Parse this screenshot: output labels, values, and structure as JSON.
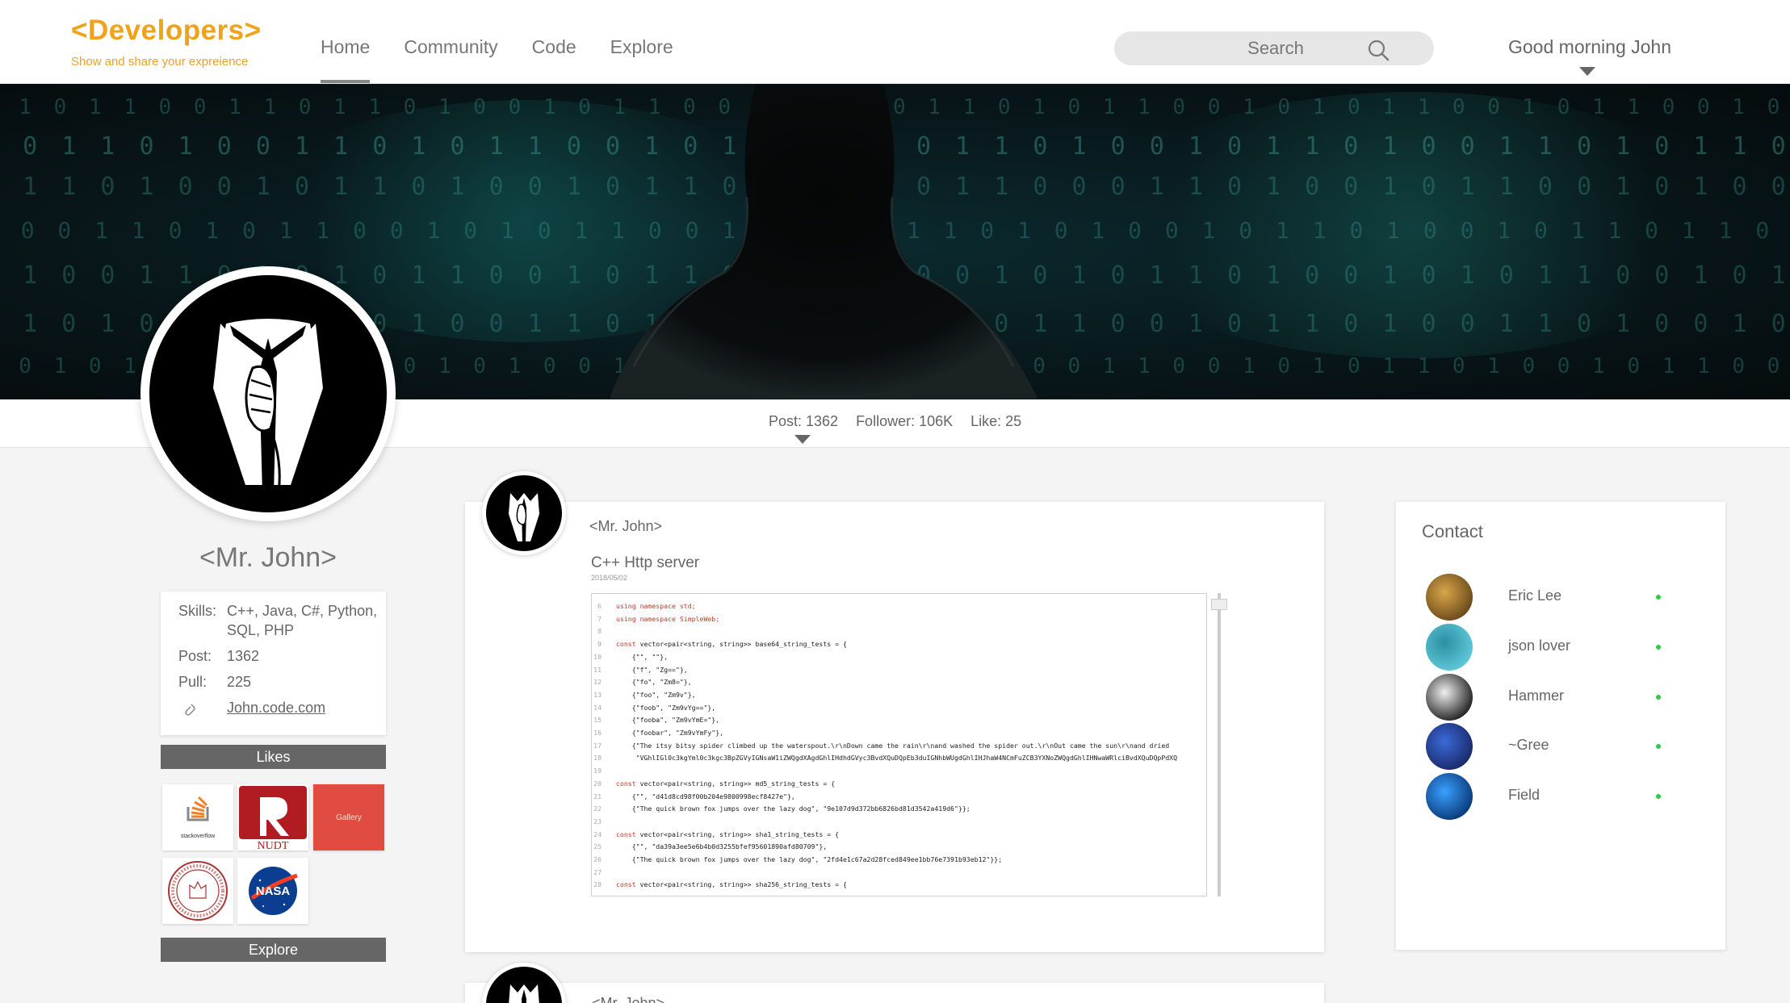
{
  "header": {
    "logo": "<Developers>",
    "tagline": "Show and share your expreience",
    "nav": [
      {
        "label": "Home",
        "active": true
      },
      {
        "label": "Community",
        "active": false
      },
      {
        "label": "Code",
        "active": false
      },
      {
        "label": "Explore",
        "active": false
      }
    ],
    "search_placeholder": "Search",
    "greeting": "Good morning John"
  },
  "stats": {
    "post": "Post: 1362",
    "follower": "Follower: 106K",
    "like": "Like: 25"
  },
  "profile": {
    "name": "<Mr. John>",
    "skills_label": "Skills:",
    "skills": "C++, Java, C#, Python, SQL, PHP",
    "post_label": "Post:",
    "post": "1362",
    "pull_label": "Pull:",
    "pull": "225",
    "link": "John.code.com",
    "likes_button": "Likes",
    "explore_button": "Explore",
    "likes": [
      {
        "name": "stackoverflow",
        "text": "stackoverflow"
      },
      {
        "name": "nudt",
        "text": "NUDT"
      },
      {
        "name": "gallery",
        "text": "Gallery"
      },
      {
        "name": "mit-seal",
        "text": ""
      },
      {
        "name": "nasa",
        "text": "NASA"
      }
    ]
  },
  "post": {
    "author": "<Mr. John>",
    "title": "C++ Http server",
    "date": "2018/05/02",
    "code": [
      {
        "n": "6",
        "kw": "using namespace std;",
        "t": ""
      },
      {
        "n": "7",
        "kw": "using namespace SimpleWeb;",
        "t": ""
      },
      {
        "n": "8",
        "kw": "",
        "t": ""
      },
      {
        "n": "9",
        "kw": "const",
        "t": " vector<pair<string, string>> base64_string_tests = {"
      },
      {
        "n": "10",
        "kw": "",
        "t": "    {\"\", \"\"},"
      },
      {
        "n": "11",
        "kw": "",
        "t": "    {\"f\", \"Zg==\"},"
      },
      {
        "n": "12",
        "kw": "",
        "t": "    {\"fo\", \"Zm8=\"},"
      },
      {
        "n": "13",
        "kw": "",
        "t": "    {\"foo\", \"Zm9v\"},"
      },
      {
        "n": "14",
        "kw": "",
        "t": "    {\"foob\", \"Zm9vYg==\"},"
      },
      {
        "n": "15",
        "kw": "",
        "t": "    {\"fooba\", \"Zm9vYmE=\"},"
      },
      {
        "n": "16",
        "kw": "",
        "t": "    {\"foobar\", \"Zm9vYmFy\"},"
      },
      {
        "n": "17",
        "kw": "",
        "t": "    {\"The itsy bitsy spider climbed up the waterspout.\\r\\nDown came the rain\\r\\nand washed the spider out.\\r\\nOut came the sun\\r\\nand dried"
      },
      {
        "n": "18",
        "kw": "",
        "t": "     \"VGhlIGl0c3kgYml0c3kgc3BpZGVyIGNsaW1iZWQgdXAgdGhlIHdhdGVyc3BvdXQuDQpEb3duIGNhbWUgdGhlIHJhaW4NCmFuZCB3YXNoZWQgdGhlIHNwaWRlciBvdXQuDQpPdXQ"
      },
      {
        "n": "19",
        "kw": "",
        "t": ""
      },
      {
        "n": "20",
        "kw": "const",
        "t": " vector<pair<string, string>> md5_string_tests = {"
      },
      {
        "n": "21",
        "kw": "",
        "t": "    {\"\", \"d41d8cd98f00b204e9800998ecf8427e\"},"
      },
      {
        "n": "22",
        "kw": "",
        "t": "    {\"The quick brown fox jumps over the lazy dog\", \"9e107d9d372bb6826bd81d3542a419d6\"}};"
      },
      {
        "n": "23",
        "kw": "",
        "t": ""
      },
      {
        "n": "24",
        "kw": "const",
        "t": " vector<pair<string, string>> sha1_string_tests = {"
      },
      {
        "n": "25",
        "kw": "",
        "t": "    {\"\", \"da39a3ee5e6b4b0d3255bfef95601890afd80709\"},"
      },
      {
        "n": "26",
        "kw": "",
        "t": "    {\"The quick brown fox jumps over the lazy dog\", \"2fd4e1c67a2d28fced849ee1bb76e7391b93eb12\"}};"
      },
      {
        "n": "27",
        "kw": "",
        "t": ""
      },
      {
        "n": "28",
        "kw": "const",
        "t": " vector<pair<string, string>> sha256_string_tests = {"
      }
    ]
  },
  "post2": {
    "author": "<Mr. John>"
  },
  "contact": {
    "title": "Contact",
    "people": [
      {
        "name": "Eric Lee",
        "color": "#6b4a1a",
        "accent": "#d9a74a"
      },
      {
        "name": "json lover",
        "color": "#5fc8d8",
        "accent": "#2b8fa3"
      },
      {
        "name": "Hammer",
        "color": "#222222",
        "accent": "#f0f0f0"
      },
      {
        "name": "~Gree",
        "color": "#1a2a6a",
        "accent": "#3a6ad8"
      },
      {
        "name": "Field",
        "color": "#0a3a7a",
        "accent": "#3aa0ff"
      }
    ],
    "online_color": "#2ecc40"
  },
  "colors": {
    "brand": "#f0a21a",
    "button": "#666666"
  }
}
